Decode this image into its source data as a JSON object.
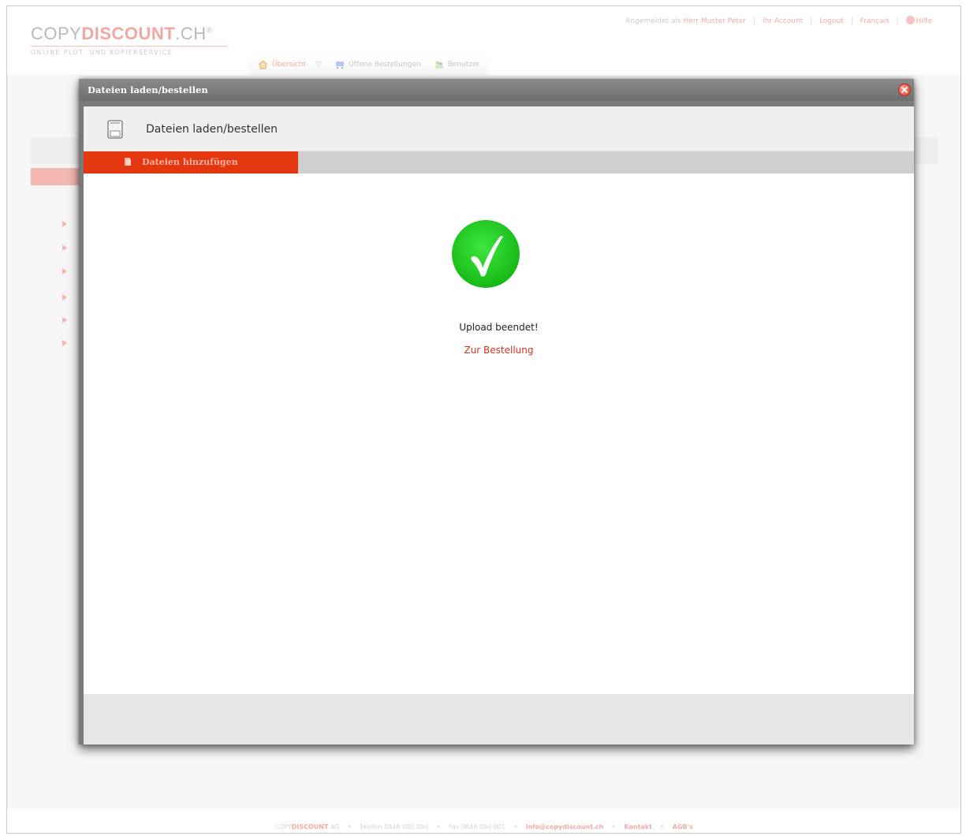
{
  "brand": {
    "name_part1": "COPY",
    "name_part2": "DISCOUNT",
    "name_part3": ".CH",
    "registered": "®",
    "tagline": "ONLINE PLOT- UND KOPIERSERVICE"
  },
  "top_links": {
    "logged_in_prefix": "Angemeldet als",
    "user_name": "Herr Muster Peter",
    "account": "Ihr Account",
    "logout": "Logout",
    "language": "Français",
    "help": "Hilfe",
    "separator": "|"
  },
  "nav": {
    "items": [
      {
        "label": "Übersicht"
      },
      {
        "label": "Offene Bestellungen"
      },
      {
        "label": "Benutzer"
      }
    ]
  },
  "modal": {
    "title": "Dateien laden/bestellen",
    "header_title": "Dateien laden/bestellen",
    "tab_label": "Dateien hinzufügen",
    "status_text": "Upload beendet!",
    "order_link": "Zur Bestellung"
  },
  "footer": {
    "brand_part1": "COPY",
    "brand_part2": "DISCOUNT",
    "brand_suffix": "AG",
    "phone": "Telefon 0848 000 000",
    "fax": "Fax 0848 000 001",
    "email": "info@copydiscount.ch",
    "contact": "Kontakt",
    "terms": "AGB's",
    "separator": "•"
  },
  "colors": {
    "accent_red": "#e4360f",
    "link_red": "#d2321e",
    "success_green": "#22cc22",
    "modal_gray": "#7a7a7a"
  },
  "icons": {
    "close": "close-icon",
    "save": "floppy-disk-icon",
    "success": "checkmark-circle-icon"
  }
}
